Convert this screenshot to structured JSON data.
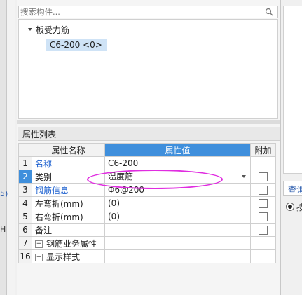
{
  "left_strip": {
    "chars": [
      "5)",
      "H"
    ]
  },
  "search": {
    "placeholder": "搜索构件..."
  },
  "tree": {
    "parent_label": "板受力筋",
    "child_label": "C6-200 <0>"
  },
  "properties": {
    "title": "属性列表",
    "headers": {
      "name": "属性名称",
      "value": "属性值",
      "add": "附加"
    },
    "rows": [
      {
        "num": "1",
        "name": "名称",
        "value": "C6-200",
        "name_blue": true,
        "checkbox": false,
        "expand": false
      },
      {
        "num": "2",
        "name": "类别",
        "value": "温度筋",
        "name_blue": false,
        "checkbox": true,
        "expand": false,
        "dropdown": true,
        "selected": true
      },
      {
        "num": "3",
        "name": "钢筋信息",
        "value": "Φ6@200",
        "name_blue": true,
        "checkbox": true,
        "expand": false
      },
      {
        "num": "4",
        "name": "左弯折(mm)",
        "value": "(0)",
        "name_blue": false,
        "checkbox": true,
        "expand": false
      },
      {
        "num": "5",
        "name": "右弯折(mm)",
        "value": "(0)",
        "name_blue": false,
        "checkbox": true,
        "expand": false
      },
      {
        "num": "6",
        "name": "备注",
        "value": "",
        "name_blue": false,
        "checkbox": true,
        "expand": false
      },
      {
        "num": "7",
        "name": "钢筋业务属性",
        "value": "",
        "name_blue": false,
        "checkbox": false,
        "expand": true
      },
      {
        "num": "16",
        "name": "显示样式",
        "value": "",
        "name_blue": false,
        "checkbox": false,
        "expand": true
      }
    ]
  },
  "right_panel": {
    "tab_label": "查询",
    "radio_label": "按"
  },
  "colors": {
    "accent": "#3f8fdc",
    "link_blue": "#1b5fcf",
    "highlight_ellipse": "#e02de0",
    "tree_selection": "#cfe3f6"
  }
}
